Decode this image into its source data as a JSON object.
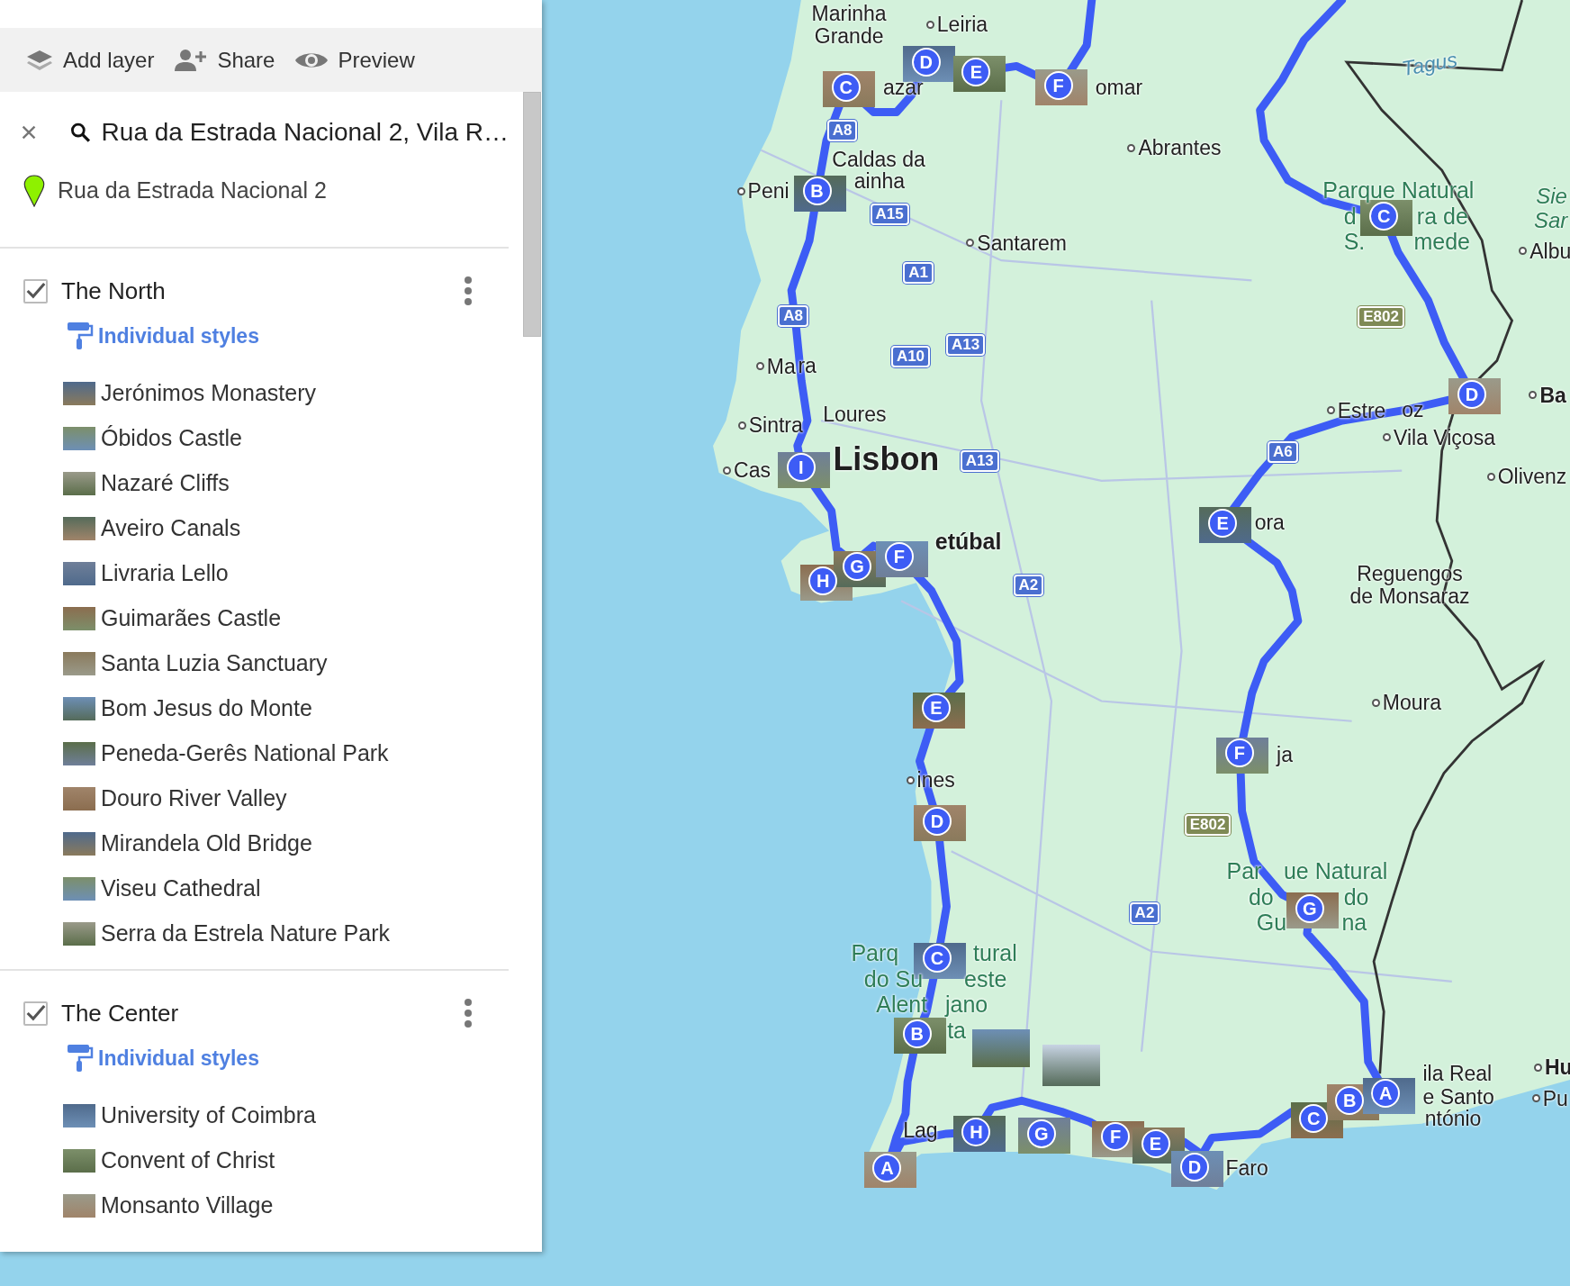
{
  "toolbar": [
    {
      "kind": "layers",
      "label": "Add layer"
    },
    {
      "kind": "share",
      "label": "Share"
    },
    {
      "kind": "preview",
      "label": "Preview"
    }
  ],
  "search": {
    "value": "Rua da Estrada Nacional 2, Vila R…"
  },
  "result": {
    "label": "Rua da Estrada Nacional 2"
  },
  "layers": [
    {
      "title": "The North",
      "checked": true,
      "style_label": "Individual styles",
      "places": [
        "Jerónimos Monastery",
        "Óbidos Castle",
        "Nazaré Cliffs",
        "Aveiro Canals",
        "Livraria Lello",
        "Guimarães Castle",
        "Santa Luzia Sanctuary",
        "Bom Jesus do Monte",
        "Peneda-Gerês National Park",
        "Douro River Valley",
        "Mirandela Old Bridge",
        "Viseu Cathedral",
        "Serra da Estrela Nature Park"
      ]
    },
    {
      "title": "The Center",
      "checked": true,
      "style_label": "Individual styles",
      "places": [
        "University of Coimbra",
        "Convent of Christ",
        "Monsanto Village"
      ]
    }
  ],
  "map": {
    "labels": [
      {
        "text": "Marinha Grande",
        "kind": "place"
      },
      {
        "text": "Leiria",
        "kind": "town"
      },
      {
        "text": "azar",
        "kind": "place"
      },
      {
        "text": "omar",
        "kind": "place"
      },
      {
        "text": "Caldas da",
        "kind": "place"
      },
      {
        "text": "ainha",
        "kind": "place"
      },
      {
        "text": "Abrantes",
        "kind": "town"
      },
      {
        "text": "Peni",
        "kind": "town"
      },
      {
        "text": "Santarem",
        "kind": "town"
      },
      {
        "text": "Ma",
        "kind": "town"
      },
      {
        "text": "ra",
        "kind": "place"
      },
      {
        "text": "Loures",
        "kind": "place"
      },
      {
        "text": "Sintra",
        "kind": "town"
      },
      {
        "text": "Lisbon",
        "kind": "city"
      },
      {
        "text": "Cas",
        "kind": "town"
      },
      {
        "text": "etúbal",
        "kind": "bold"
      },
      {
        "text": "ora",
        "kind": "place"
      },
      {
        "text": "Estre",
        "kind": "town"
      },
      {
        "text": "oz",
        "kind": "place"
      },
      {
        "text": "Vila Viçosa",
        "kind": "town"
      },
      {
        "text": "Sie",
        "kind": "region"
      },
      {
        "text": "Sar",
        "kind": "region"
      },
      {
        "text": "Albu",
        "kind": "town"
      },
      {
        "text": "Ba",
        "kind": "boldtown"
      },
      {
        "text": "Olivenz",
        "kind": "town"
      },
      {
        "text": "Tagus",
        "kind": "river"
      },
      {
        "text": "Parque Natural",
        "kind": "park"
      },
      {
        "text": "d",
        "kind": "park"
      },
      {
        "text": "ra de",
        "kind": "park"
      },
      {
        "text": "S.",
        "kind": "park"
      },
      {
        "text": "mede",
        "kind": "park"
      },
      {
        "text": "Reguengos de Monsaraz",
        "kind": "place"
      },
      {
        "text": "Moura",
        "kind": "town"
      },
      {
        "text": "ja",
        "kind": "place"
      },
      {
        "text": "ines",
        "kind": "town"
      },
      {
        "text": "Parq",
        "kind": "park"
      },
      {
        "text": "tural",
        "kind": "park"
      },
      {
        "text": "do Su",
        "kind": "park"
      },
      {
        "text": "este",
        "kind": "park"
      },
      {
        "text": "Alent",
        "kind": "park"
      },
      {
        "text": "jano",
        "kind": "park"
      },
      {
        "text": "ta",
        "kind": "park"
      },
      {
        "text": "Par",
        "kind": "park"
      },
      {
        "text": "ue Natural",
        "kind": "park"
      },
      {
        "text": "do",
        "kind": "park"
      },
      {
        "text": "do",
        "kind": "park"
      },
      {
        "text": "Gu",
        "kind": "park"
      },
      {
        "text": "na",
        "kind": "park"
      },
      {
        "text": "Lag",
        "kind": "place"
      },
      {
        "text": "Faro",
        "kind": "place"
      },
      {
        "text": "ila Real",
        "kind": "place"
      },
      {
        "text": "e Santo",
        "kind": "place"
      },
      {
        "text": "ntónio",
        "kind": "place"
      },
      {
        "text": "Hu",
        "kind": "boldtown"
      },
      {
        "text": "Pu",
        "kind": "town"
      },
      {
        "text": "A8",
        "kind": "shield"
      },
      {
        "text": "A15",
        "kind": "shield"
      },
      {
        "text": "A1",
        "kind": "shield"
      },
      {
        "text": "A8",
        "kind": "shield"
      },
      {
        "text": "A10",
        "kind": "shield"
      },
      {
        "text": "A13",
        "kind": "shield"
      },
      {
        "text": "A13",
        "kind": "shield"
      },
      {
        "text": "A2",
        "kind": "shield"
      },
      {
        "text": "A6",
        "kind": "shield"
      },
      {
        "text": "E802",
        "kind": "euro"
      },
      {
        "text": "E802",
        "kind": "euro"
      },
      {
        "text": "A2",
        "kind": "shield"
      }
    ],
    "markers": [
      {
        "letter": "C"
      },
      {
        "letter": "D"
      },
      {
        "letter": "E"
      },
      {
        "letter": "F"
      },
      {
        "letter": "B"
      },
      {
        "letter": "I"
      },
      {
        "letter": "H"
      },
      {
        "letter": "G"
      },
      {
        "letter": "F"
      },
      {
        "letter": "E"
      },
      {
        "letter": "D"
      },
      {
        "letter": "C"
      },
      {
        "letter": "B"
      },
      {
        "letter": "A"
      },
      {
        "letter": "H"
      },
      {
        "letter": "G"
      },
      {
        "letter": "F"
      },
      {
        "letter": "E"
      },
      {
        "letter": "D"
      },
      {
        "letter": "C"
      },
      {
        "letter": "B"
      },
      {
        "letter": "A"
      },
      {
        "letter": "C"
      },
      {
        "letter": "D"
      },
      {
        "letter": "E"
      },
      {
        "letter": "F"
      },
      {
        "letter": "G"
      }
    ]
  }
}
